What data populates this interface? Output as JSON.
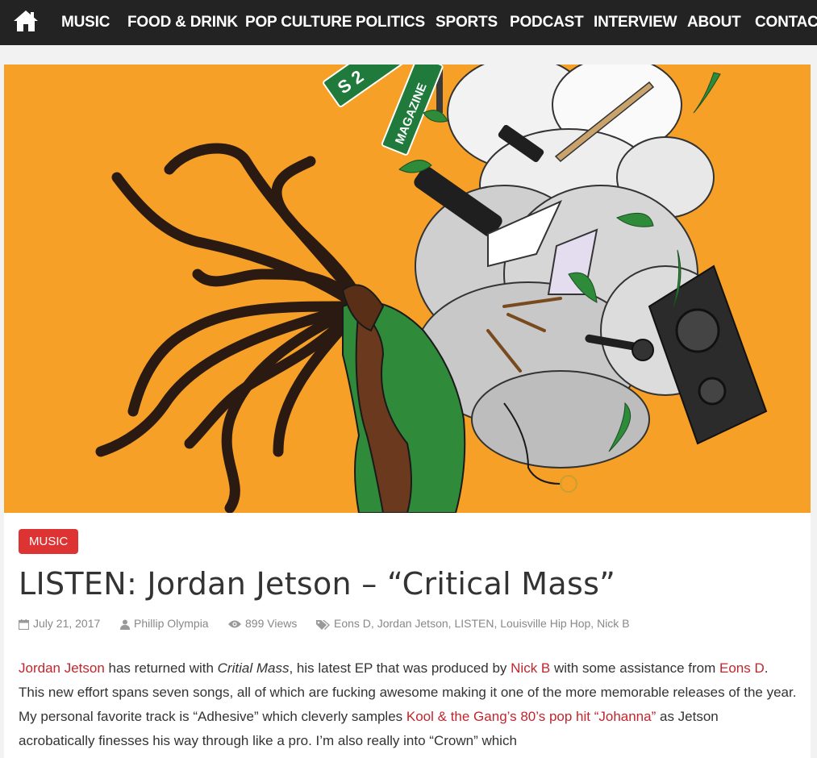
{
  "nav": {
    "items": [
      "MUSIC",
      "FOOD & DRINK",
      "POP CULTURE",
      "POLITICS",
      "SPORTS",
      "PODCAST",
      "INTERVIEW",
      "ABOUT",
      "CONTACT"
    ]
  },
  "hero": {
    "sign_text_1": "S 2",
    "sign_text_2": "MAGAZINE",
    "colors": {
      "background": "#f6a027",
      "cloud": "#d9d9d9",
      "shirt": "#2f8a3a"
    }
  },
  "post": {
    "category": "MUSIC",
    "title": "LISTEN: Jordan Jetson – “Critical Mass”",
    "date": "July 21, 2017",
    "author": "Phillip Olympia",
    "views": "899 Views",
    "tags": [
      "Eons D",
      "Jordan Jetson",
      "LISTEN",
      "Louisville Hip Hop",
      "Nick B"
    ],
    "body": {
      "l1_link1": "Jordan Jetson",
      "l1_t1": " has returned with ",
      "l1_em": "Critial Mass",
      "l1_t2": ", his latest EP that was produced by ",
      "l1_link2": "Nick B",
      "l1_t3": " with some assistance from ",
      "l2_link1": "Eons D",
      "l2_t1": ". This new effort spans seven songs, all of which are fucking awesome making it one of the more memorable releases of the year. My personal favorite track is “Adhesive” which cleverly samples ",
      "l3_link1": "Kool & the Gang’s 80’s pop hit “Johanna”",
      "l3_t1": " as Jetson acrobatically finesses his way through like a pro. I’m also really into “Crown” which"
    }
  },
  "colors": {
    "accent": "#dd3333",
    "link": "#c0262d",
    "nav_bg": "#232323"
  }
}
